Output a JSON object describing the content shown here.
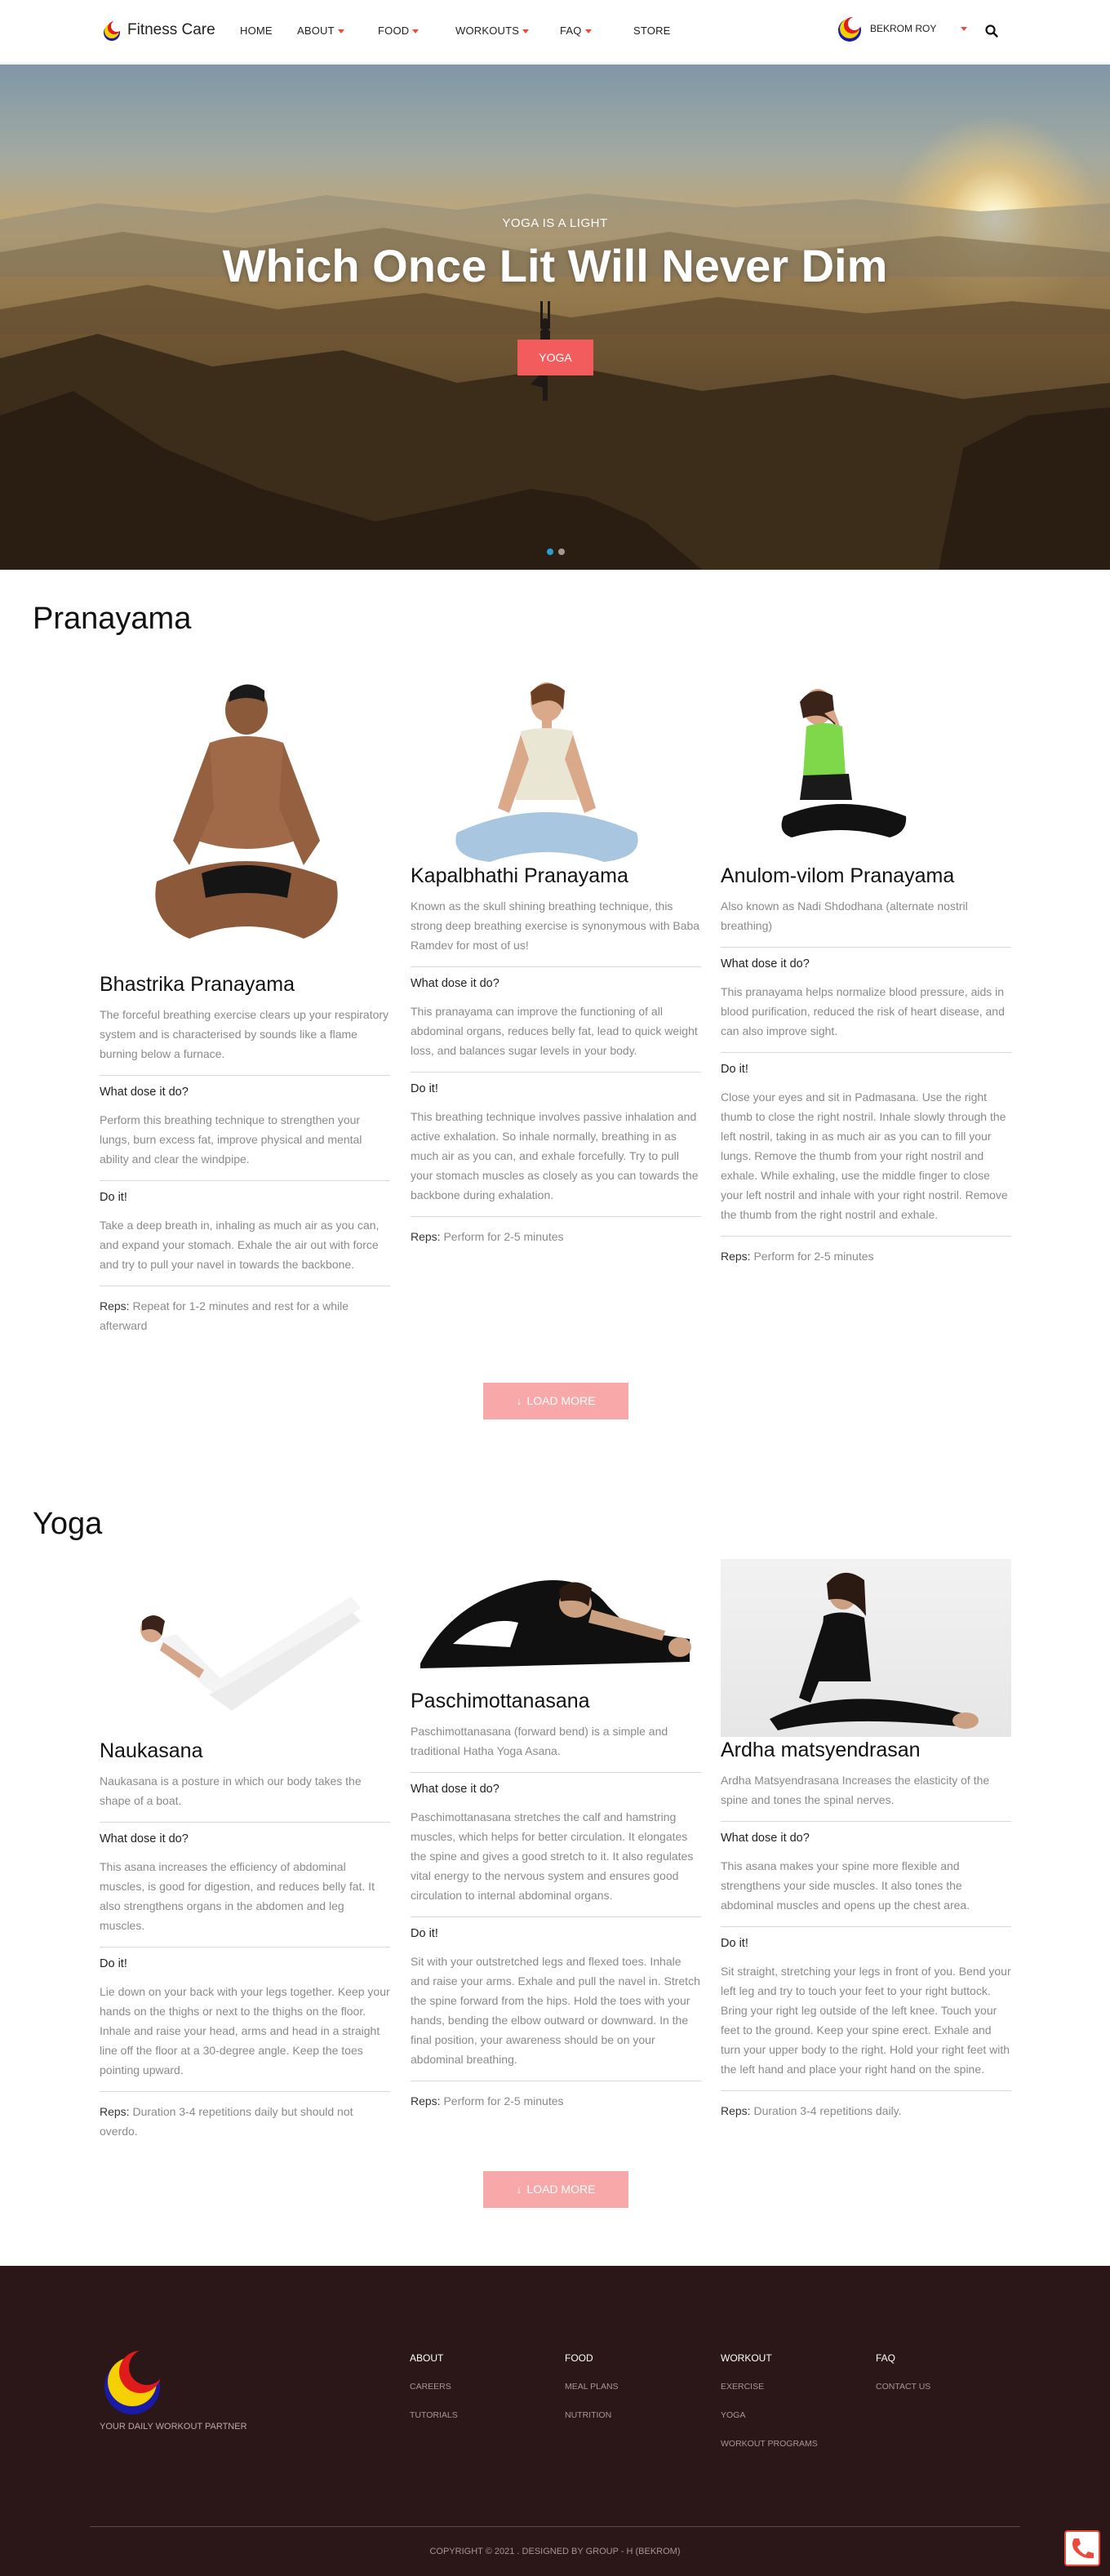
{
  "nav": {
    "brand": "Fitness Care",
    "items": [
      "HOME",
      "ABOUT",
      "FOOD",
      "WORKOUTS",
      "FAQ",
      "STORE"
    ],
    "user": "BEKROM ROY",
    "accent": "#e74c3c"
  },
  "hero": {
    "eyebrow": "YOGA IS A LIGHT",
    "title": "Which Once Lit Will Never Dim",
    "button": "YOGA",
    "slides": 2,
    "active_slide": 1
  },
  "pranayama": {
    "title": "Pranayama",
    "load_more": "LOAD MORE",
    "cards": [
      {
        "name": "Bhastrika Pranayama",
        "desc": "The forceful breathing exercise clears up your respiratory system and is characterised by sounds like a flame burning below a furnace.",
        "q1": "What dose it do?",
        "a1": "Perform this breathing technique to strengthen your lungs, burn excess fat, improve physical and mental ability and clear the windpipe.",
        "q2": "Do it!",
        "a2": "Take a deep breath in, inhaling as much air as you can, and expand your stomach. Exhale the air out with force and try to pull your navel in towards the backbone.",
        "reps_label": "Reps:",
        "reps": "Repeat for 1-2 minutes and rest for a while afterward"
      },
      {
        "name": "Kapalbhathi Pranayama",
        "desc": "Known as the skull shining breathing technique, this strong deep breathing exercise is synonymous with Baba Ramdev for most of us!",
        "q1": "What dose it do?",
        "a1": "This pranayama can improve the functioning of all abdominal organs, reduces belly fat, lead to quick weight loss, and balances sugar levels in your body.",
        "q2": "Do it!",
        "a2": "This breathing technique involves passive inhalation and active exhalation. So inhale normally, breathing in as much air as you can, and exhale forcefully. Try to pull your stomach muscles as closely as you can towards the backbone during exhalation.",
        "reps_label": "Reps:",
        "reps": "Perform for 2-5 minutes"
      },
      {
        "name": "Anulom-vilom Pranayama",
        "desc": "Also known as Nadi Shdodhana (alternate nostril breathing)",
        "q1": "What dose it do?",
        "a1": "This pranayama helps normalize blood pressure, aids in blood purification, reduced the risk of heart disease, and can also improve sight.",
        "q2": "Do it!",
        "a2": "Close your eyes and sit in Padmasana. Use the right thumb to close the right nostril. Inhale slowly through the left nostril, taking in as much air as you can to fill your lungs. Remove the thumb from your right nostril and exhale. While exhaling, use the middle finger to close your left nostril and inhale with your right nostril. Remove the thumb from the right nostril and exhale.",
        "reps_label": "Reps:",
        "reps": "Perform for 2-5 minutes"
      }
    ]
  },
  "yoga": {
    "title": "Yoga",
    "load_more": "LOAD MORE",
    "cards": [
      {
        "name": "Naukasana",
        "desc": "Naukasana is a posture in which our body takes the shape of a boat.",
        "q1": "What dose it do?",
        "a1": "This asana increases the efficiency of abdominal muscles, is good for digestion, and reduces belly fat. It also strengthens organs in the abdomen and leg muscles.",
        "q2": "Do it!",
        "a2": "Lie down on your back with your legs together. Keep your hands on the thighs or next to the thighs on the floor. Inhale and raise your head, arms and head in a straight line off the floor at a 30-degree angle. Keep the toes pointing upward.",
        "reps_label": "Reps:",
        "reps": "Duration 3-4 repetitions daily but should not overdo."
      },
      {
        "name": "Paschimottanasana",
        "desc": "Paschimottanasana (forward bend) is a simple and traditional Hatha Yoga Asana.",
        "q1": "What dose it do?",
        "a1": "Paschimottanasana stretches the calf and hamstring muscles, which helps for better circulation. It elongates the spine and gives a good stretch to it. It also regulates vital energy to the nervous system and ensures good circulation to internal abdominal organs.",
        "q2": "Do it!",
        "a2": "Sit with your outstretched legs and flexed toes. Inhale and raise your arms. Exhale and pull the navel in. Stretch the spine forward from the hips. Hold the toes with your hands, bending the elbow outward or downward. In the final position, your awareness should be on your abdominal breathing.",
        "reps_label": "Reps:",
        "reps": "Perform for 2-5 minutes"
      },
      {
        "name": "Ardha matsyendrasan",
        "desc": "Ardha Matsyendrasana Increases the elasticity of the spine and tones the spinal nerves.",
        "q1": "What dose it do?",
        "a1": "This asana makes your spine more flexible and strengthens your side muscles. It also tones the abdominal muscles and opens up the chest area.",
        "q2": "Do it!",
        "a2": "Sit straight, stretching your legs in front of you. Bend your left leg and try to touch your feet to your right buttock. Bring your right leg outside of the left knee. Touch your feet to the ground. Keep your spine erect. Exhale and turn your upper body to the right. Hold your right feet with the left hand and place your right hand on the spine.",
        "reps_label": "Reps:",
        "reps": "Duration 3-4 repetitions daily."
      }
    ]
  },
  "footer": {
    "tagline": "YOUR DAILY WORKOUT PARTNER",
    "columns": [
      {
        "title": "ABOUT",
        "links": [
          "CAREERS",
          "TUTORIALS"
        ]
      },
      {
        "title": "FOOD",
        "links": [
          "MEAL PLANS",
          "NUTRITION"
        ]
      },
      {
        "title": "WORKOUT",
        "links": [
          "EXERCISE",
          "YOGA",
          "WORKOUT PROGRAMS"
        ]
      },
      {
        "title": "FAQ",
        "links": [
          "CONTACT US"
        ]
      }
    ],
    "copyright_pre": "COPYRIGHT",
    "copyright_symbol": "©",
    "copyright_post": "2021 . DESIGNED BY GROUP - H (",
    "designer": "BEKROM",
    "copyright_end": ")",
    "background": "#2b1718"
  }
}
